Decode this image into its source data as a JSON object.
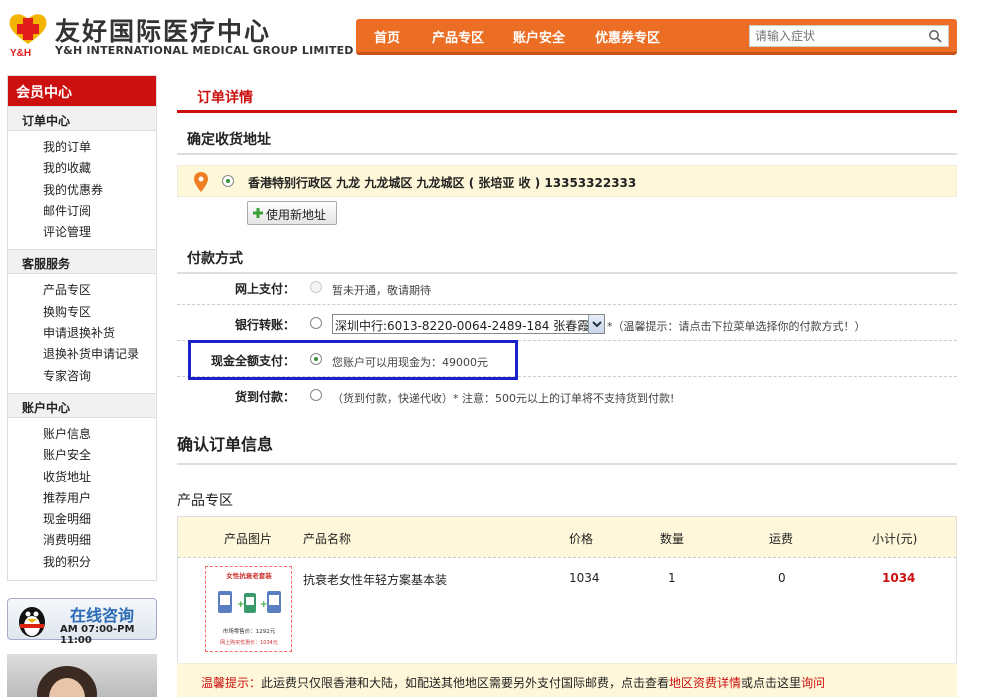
{
  "brand": {
    "name_cn": "友好国际医疗中心",
    "name_en": "Y&H INTERNATIONAL MEDICAL GROUP LIMITED",
    "mark_text": "Y&H",
    "accent": "#cc1010",
    "nav_color": "#ec6e24"
  },
  "nav": {
    "items": [
      "首页",
      "产品专区",
      "账户安全",
      "优惠券专区"
    ],
    "search_placeholder": "请输入症状"
  },
  "sidebar": {
    "title": "会员中心",
    "sections": [
      {
        "title": "订单中心",
        "items": [
          "我的订单",
          "我的收藏",
          "我的优惠券",
          "邮件订阅",
          "评论管理"
        ]
      },
      {
        "title": "客服服务",
        "items": [
          "产品专区",
          "换购专区",
          "申请退换补货",
          "退换补货申请记录",
          "专家咨询"
        ]
      },
      {
        "title": "账户中心",
        "items": [
          "账户信息",
          "账户安全",
          "收货地址",
          "推荐用户",
          "现金明细",
          "消费明细",
          "我的积分"
        ]
      }
    ],
    "online_title": "在线咨询",
    "online_hours": "AM 07:00-PM 11:00"
  },
  "main": {
    "page_title": "订单详情",
    "address_heading": "确定收货地址",
    "address_text": "香港特别行政区  九龙  九龙城区  九龙城区  ( 张培亚  收 )   13353322333",
    "new_address_button": "使用新地址",
    "payment_heading": "付款方式",
    "payments": [
      {
        "label": "网上支付：",
        "text": "暂未开通，敬请期待",
        "state": "disabled"
      },
      {
        "label": "银行转账：",
        "select_value": "深圳中行:6013-8220-0064-2489-184 张春霞",
        "note": "*（温馨提示：请点击下拉菜单选择你的付款方式！）",
        "state": "unchecked"
      },
      {
        "label": "现金全额支付：",
        "text": "您账户可以用现金为：49000元",
        "state": "checked"
      },
      {
        "label": "货到付款：",
        "text": "（货到付款，快递代收）* 注意：500元以上的订单将不支持货到付款!",
        "state": "unchecked"
      }
    ],
    "confirm_heading": "确认订单信息",
    "products_heading": "产品专区",
    "table": {
      "headers": [
        "产品图片",
        "产品名称",
        "价格",
        "数量",
        "运费",
        "小计(元)"
      ],
      "rows": [
        {
          "name": "抗衰老女性年轻方案基本装",
          "price": "1034",
          "qty": "1",
          "shipping": "0",
          "subtotal": "1034"
        }
      ]
    },
    "product_image_text": {
      "banner": "女性抗衰老套装",
      "line1": "市场零售价：1292元",
      "line2": "网上购买优惠价：1034元"
    },
    "notice": {
      "prefix": "温馨提示：",
      "text": "此运费只仅限香港和大陆，如配送其他地区需要另外支付国际邮费，点击查看",
      "link1": "地区资费详情",
      "mid": "或点击这里",
      "link2": "询问"
    }
  }
}
